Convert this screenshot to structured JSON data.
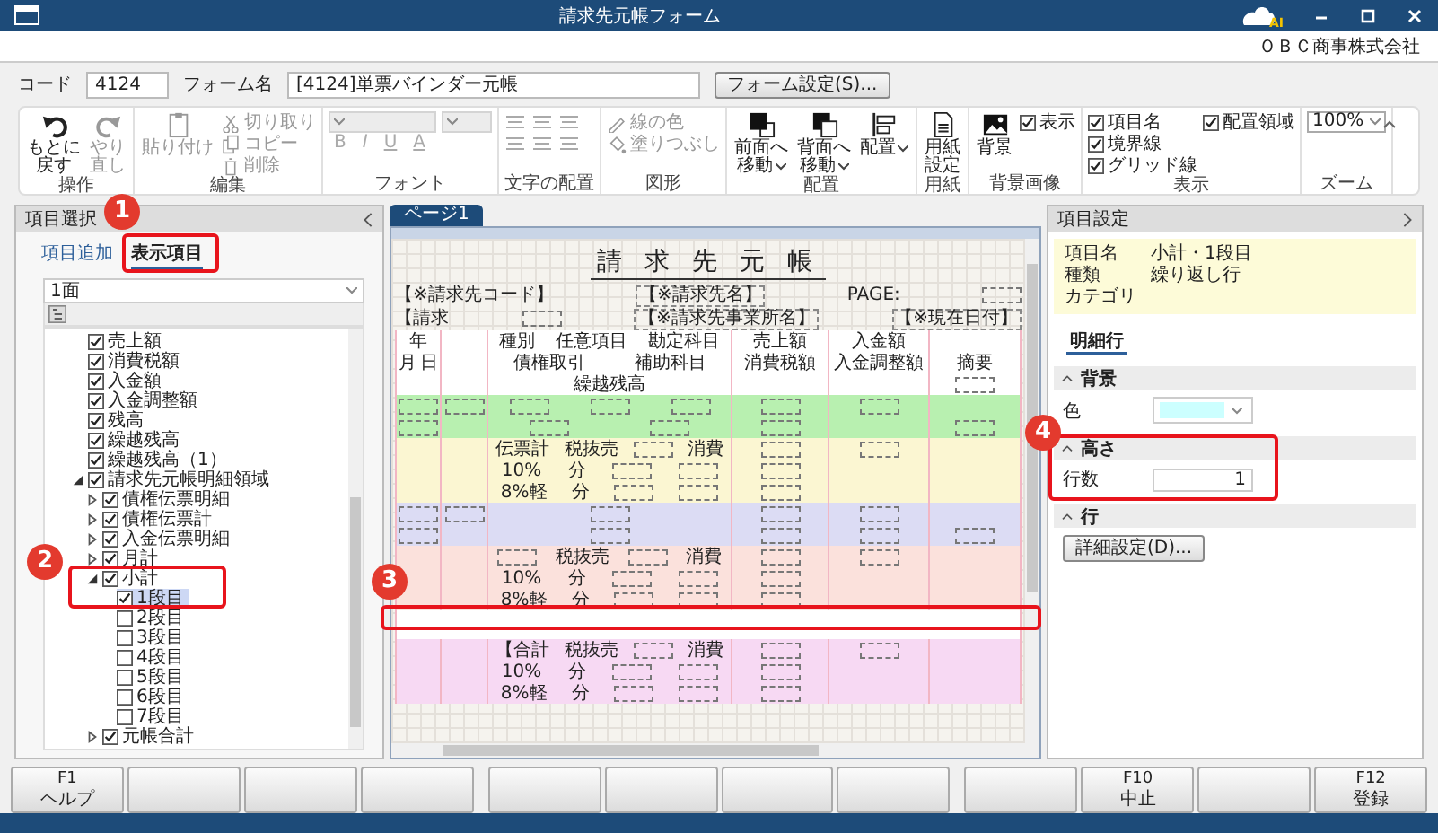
{
  "window": {
    "title": "請求先元帳フォーム",
    "logo_text": "AI"
  },
  "company": "ＯＢＣ商事株式会社",
  "form_bar": {
    "code_label": "コード",
    "code": "4124",
    "name_label": "フォーム名",
    "name": "[4124]単票バインダー元帳",
    "settings_button": "フォーム設定(S)..."
  },
  "ribbon": {
    "groups": [
      {
        "label": "操作",
        "controls": [
          {
            "kind": "large",
            "lines": [
              "もとに",
              "戻す"
            ],
            "disabled": false
          },
          {
            "kind": "large",
            "lines": [
              "やり",
              "直し"
            ],
            "disabled": true
          }
        ]
      },
      {
        "label": "編集",
        "controls": [
          {
            "kind": "large",
            "lines": [
              "貼り付け"
            ],
            "disabled": true
          },
          {
            "kind": "small",
            "text": "切り取り",
            "disabled": true
          },
          {
            "kind": "small",
            "text": "コピー",
            "disabled": true
          },
          {
            "kind": "small",
            "text": "削除",
            "disabled": true
          }
        ]
      },
      {
        "label": "フォント",
        "controls": [
          {
            "kind": "dropdown",
            "disabled": true
          },
          {
            "kind": "dropdown",
            "disabled": true
          },
          {
            "kind": "format",
            "text": "B",
            "disabled": true
          },
          {
            "kind": "format",
            "text": "I",
            "disabled": true
          },
          {
            "kind": "format",
            "text": "U",
            "disabled": true
          },
          {
            "kind": "format",
            "text": "A",
            "disabled": true
          }
        ]
      },
      {
        "label": "文字の配置",
        "controls": [
          {
            "kind": "align",
            "disabled": true
          },
          {
            "kind": "align",
            "disabled": true
          },
          {
            "kind": "align",
            "disabled": true
          },
          {
            "kind": "align",
            "disabled": true
          },
          {
            "kind": "align",
            "disabled": true
          },
          {
            "kind": "align",
            "disabled": true
          }
        ]
      },
      {
        "label": "図形",
        "controls": [
          {
            "kind": "small",
            "text": "線の色",
            "disabled": true
          },
          {
            "kind": "small",
            "text": "塗りつぶし",
            "disabled": true
          }
        ]
      },
      {
        "label": "配置",
        "controls": [
          {
            "kind": "large",
            "lines": [
              "前面へ",
              "移動"
            ],
            "menu": true,
            "disabled": false
          },
          {
            "kind": "large",
            "lines": [
              "背面へ",
              "移動"
            ],
            "menu": true,
            "disabled": false
          },
          {
            "kind": "large",
            "lines": [
              "配置"
            ],
            "menu": true,
            "disabled": false
          }
        ]
      },
      {
        "label": "用紙",
        "controls": [
          {
            "kind": "large",
            "lines": [
              "用紙",
              "設定"
            ],
            "disabled": false
          }
        ]
      },
      {
        "label": "背景画像",
        "controls": [
          {
            "kind": "large",
            "lines": [
              "背景"
            ],
            "disabled": false
          },
          {
            "kind": "checkbox",
            "text": "表示",
            "checked": true
          }
        ]
      },
      {
        "label": "表示",
        "controls": [
          {
            "kind": "checkbox",
            "text": "項目名",
            "checked": true
          },
          {
            "kind": "checkbox",
            "text": "境界線",
            "checked": true
          },
          {
            "kind": "checkbox",
            "text": "グリッド線",
            "checked": true
          },
          {
            "kind": "checkbox",
            "text": "配置領域",
            "checked": true
          }
        ]
      },
      {
        "label": "ズーム",
        "controls": [
          {
            "kind": "dropdown",
            "text": "100%",
            "disabled": false
          }
        ]
      }
    ]
  },
  "selector": {
    "title": "項目選択",
    "tabs": [
      {
        "label": "項目追加",
        "selected": false
      },
      {
        "label": "表示項目",
        "selected": true
      }
    ],
    "page_select": "1面",
    "tree": [
      {
        "label": "売上額",
        "checked": true,
        "selected": false
      },
      {
        "label": "消費税額",
        "checked": true,
        "selected": false
      },
      {
        "label": "入金額",
        "checked": true,
        "selected": false
      },
      {
        "label": "入金調整額",
        "checked": true,
        "selected": false
      },
      {
        "label": "残高",
        "checked": true,
        "selected": false
      },
      {
        "label": "繰越残高",
        "checked": true,
        "selected": false
      },
      {
        "label": "繰越残高（1）",
        "checked": true,
        "selected": false
      },
      {
        "label": "請求先元帳明細領域",
        "checked": true,
        "selected": false,
        "expanded": true,
        "children": [
          {
            "label": "債権伝票明細",
            "checked": true,
            "selected": false,
            "expanded": false
          },
          {
            "label": "債権伝票計",
            "checked": true,
            "selected": false,
            "expanded": false
          },
          {
            "label": "入金伝票明細",
            "checked": true,
            "selected": false,
            "expanded": false
          },
          {
            "label": "月計",
            "checked": true,
            "selected": false,
            "expanded": false
          },
          {
            "label": "小計",
            "checked": true,
            "selected": false,
            "expanded": true,
            "children": [
              {
                "label": "1段目",
                "checked": true,
                "selected": true
              },
              {
                "label": "2段目",
                "checked": false,
                "selected": false
              },
              {
                "label": "3段目",
                "checked": false,
                "selected": false
              },
              {
                "label": "4段目",
                "checked": false,
                "selected": false
              },
              {
                "label": "5段目",
                "checked": false,
                "selected": false
              },
              {
                "label": "6段目",
                "checked": false,
                "selected": false
              },
              {
                "label": "7段目",
                "checked": false,
                "selected": false
              }
            ]
          },
          {
            "label": "元帳合計",
            "checked": true,
            "selected": false,
            "expanded": false
          }
        ]
      }
    ]
  },
  "designer": {
    "tabs": [
      {
        "label": "ページ1",
        "selected": true
      }
    ],
    "form": {
      "title": "請 求 先 元 帳",
      "top_lines": [
        [
          {
            "kind": "label",
            "text": "【※請求先コード】"
          },
          {
            "kind": "field",
            "text": "【※請求先名】"
          },
          {
            "kind": "label",
            "text": "PAGE:"
          },
          {
            "kind": "slot"
          }
        ],
        [
          {
            "kind": "label",
            "text": "【請求"
          },
          {
            "kind": "slot"
          },
          {
            "kind": "field",
            "text": "【※請求先事業所名】"
          },
          {
            "kind": "field",
            "text": "【※現在日付】"
          }
        ]
      ],
      "bands": [
        {
          "kind": "rows",
          "color": "#ffffff",
          "lines": [
            {
              "column_1": [
                {
                  "kind": "label",
                  "text": "年"
                }
              ],
              "column_3": [
                {
                  "kind": "label",
                  "text": "種別"
                },
                {
                  "kind": "label",
                  "text": "任意項目"
                },
                {
                  "kind": "label",
                  "text": "勘定科目"
                }
              ],
              "column_4": [
                {
                  "kind": "label",
                  "text": "売上額"
                }
              ],
              "column_5": [
                {
                  "kind": "label",
                  "text": "入金額"
                }
              ]
            },
            {
              "column_1": [
                {
                  "kind": "label",
                  "text": "月"
                },
                {
                  "kind": "label",
                  "text": "日"
                }
              ],
              "column_3": [
                {
                  "kind": "label",
                  "text": "債権取引"
                },
                {
                  "kind": "label",
                  "text": "補助科目"
                }
              ],
              "column_4": [
                {
                  "kind": "label",
                  "text": "消費税額"
                }
              ],
              "column_5": [
                {
                  "kind": "label",
                  "text": "入金調整額"
                }
              ],
              "column_6": [
                {
                  "kind": "label",
                  "text": "摘要"
                }
              ]
            },
            {
              "column_3": [
                {
                  "kind": "label",
                  "text": "繰越残高"
                }
              ],
              "column_6": [
                {
                  "kind": "slot"
                }
              ]
            }
          ]
        },
        {
          "kind": "rows",
          "color": "#b8f0b0",
          "lines": [
            {
              "column_1": [
                {
                  "kind": "slot"
                }
              ],
              "column_2": [
                {
                  "kind": "slot"
                }
              ],
              "column_3": [
                {
                  "kind": "slot"
                },
                {
                  "kind": "slot"
                },
                {
                  "kind": "slot"
                }
              ],
              "column_4": [
                {
                  "kind": "slot"
                }
              ],
              "column_5": [
                {
                  "kind": "slot"
                }
              ]
            },
            {
              "column_1": [
                {
                  "kind": "slot"
                }
              ],
              "column_3": [
                {
                  "kind": "slot"
                },
                {
                  "kind": "slot"
                }
              ],
              "column_4": [
                {
                  "kind": "slot"
                }
              ],
              "column_6": [
                {
                  "kind": "slot"
                }
              ]
            }
          ]
        },
        {
          "kind": "rows",
          "color": "#fbf6d2",
          "lines": [
            {
              "column_3": [
                {
                  "kind": "label",
                  "text": "伝票計"
                },
                {
                  "kind": "label",
                  "text": "税抜売"
                },
                {
                  "kind": "slot"
                },
                {
                  "kind": "label",
                  "text": "消費"
                }
              ],
              "column_4": [
                {
                  "kind": "slot"
                }
              ],
              "column_5": [
                {
                  "kind": "slot"
                }
              ]
            },
            {
              "column_3": [
                {
                  "kind": "label",
                  "text": "10%"
                },
                {
                  "kind": "label",
                  "text": "分"
                },
                {
                  "kind": "slot"
                },
                {
                  "kind": "slot"
                }
              ],
              "column_4": [
                {
                  "kind": "slot"
                }
              ]
            },
            {
              "column_3": [
                {
                  "kind": "label",
                  "text": "8%軽"
                },
                {
                  "kind": "label",
                  "text": "分"
                },
                {
                  "kind": "slot"
                },
                {
                  "kind": "slot"
                }
              ],
              "column_4": [
                {
                  "kind": "slot"
                }
              ]
            }
          ]
        },
        {
          "kind": "rows",
          "color": "#dcdcf4",
          "lines": [
            {
              "column_1": [
                {
                  "kind": "slot"
                }
              ],
              "column_2": [
                {
                  "kind": "slot"
                }
              ],
              "column_3": [
                {
                  "kind": "slot"
                }
              ],
              "column_4": [
                {
                  "kind": "slot"
                }
              ],
              "column_5": [
                {
                  "kind": "slot"
                }
              ]
            },
            {
              "column_1": [
                {
                  "kind": "slot"
                }
              ],
              "column_3": [
                {
                  "kind": "slot"
                }
              ],
              "column_4": [
                {
                  "kind": "slot"
                }
              ],
              "column_5": [
                {
                  "kind": "slot"
                }
              ],
              "column_6": [
                {
                  "kind": "slot"
                }
              ]
            }
          ]
        },
        {
          "kind": "rows",
          "color": "#fbe1dc",
          "lines": [
            {
              "column_3": [
                {
                  "kind": "slot"
                },
                {
                  "kind": "label",
                  "text": "税抜売"
                },
                {
                  "kind": "slot"
                },
                {
                  "kind": "label",
                  "text": "消費"
                }
              ],
              "column_4": [
                {
                  "kind": "slot"
                }
              ],
              "column_5": [
                {
                  "kind": "slot"
                }
              ]
            },
            {
              "column_3": [
                {
                  "kind": "label",
                  "text": "10%"
                },
                {
                  "kind": "label",
                  "text": "分"
                },
                {
                  "kind": "slot"
                },
                {
                  "kind": "slot"
                }
              ],
              "column_4": [
                {
                  "kind": "slot"
                }
              ]
            },
            {
              "column_3": [
                {
                  "kind": "label",
                  "text": "8%軽"
                },
                {
                  "kind": "label",
                  "text": "分"
                },
                {
                  "kind": "slot"
                },
                {
                  "kind": "slot"
                }
              ],
              "column_4": [
                {
                  "kind": "slot"
                }
              ]
            }
          ]
        },
        {
          "kind": "spacer",
          "color": "#ffffff"
        },
        {
          "kind": "rows",
          "color": "#f7d9f3",
          "lines": [
            {
              "column_3": [
                {
                  "kind": "label",
                  "text": "【合計"
                },
                {
                  "kind": "label",
                  "text": "税抜売"
                },
                {
                  "kind": "slot"
                },
                {
                  "kind": "label",
                  "text": "消費"
                }
              ],
              "column_4": [
                {
                  "kind": "slot"
                }
              ],
              "column_5": [
                {
                  "kind": "slot"
                }
              ]
            },
            {
              "column_3": [
                {
                  "kind": "label",
                  "text": "10%"
                },
                {
                  "kind": "label",
                  "text": "分"
                },
                {
                  "kind": "slot"
                },
                {
                  "kind": "slot"
                }
              ],
              "column_4": [
                {
                  "kind": "slot"
                }
              ]
            },
            {
              "column_3": [
                {
                  "kind": "label",
                  "text": "8%軽"
                },
                {
                  "kind": "label",
                  "text": "分"
                },
                {
                  "kind": "slot"
                },
                {
                  "kind": "slot"
                }
              ],
              "column_4": [
                {
                  "kind": "slot"
                }
              ]
            }
          ]
        }
      ]
    }
  },
  "properties": {
    "title": "項目設定",
    "info": [
      {
        "label": "項目名",
        "value": "小計・1段目"
      },
      {
        "label": "種類",
        "value": "繰り返し行"
      },
      {
        "label": "カテゴリ"
      }
    ],
    "tab": "明細行",
    "sections": [
      {
        "title": "背景",
        "expanded": true,
        "kind": "color",
        "label": "色",
        "color": "#ccffff"
      },
      {
        "title": "高さ",
        "expanded": true,
        "kind": "number",
        "label": "行数",
        "value": "1"
      },
      {
        "title": "行",
        "expanded": true,
        "kind": "button",
        "button": "詳細設定(D)..."
      }
    ]
  },
  "function_keys": [
    {
      "kind": "key",
      "key": "F1",
      "label": "ヘルプ"
    },
    {
      "kind": "blank"
    },
    {
      "kind": "blank"
    },
    {
      "kind": "blank"
    },
    {
      "kind": "blank"
    },
    {
      "kind": "blank"
    },
    {
      "kind": "blank"
    },
    {
      "kind": "blank"
    },
    {
      "kind": "blank"
    },
    {
      "kind": "key",
      "key": "F10",
      "label": "中止"
    },
    {
      "kind": "blank"
    },
    {
      "kind": "key",
      "key": "F12",
      "label": "登録"
    }
  ],
  "callouts": [
    {
      "number": "1"
    },
    {
      "number": "2"
    },
    {
      "number": "3"
    },
    {
      "number": "4"
    }
  ]
}
